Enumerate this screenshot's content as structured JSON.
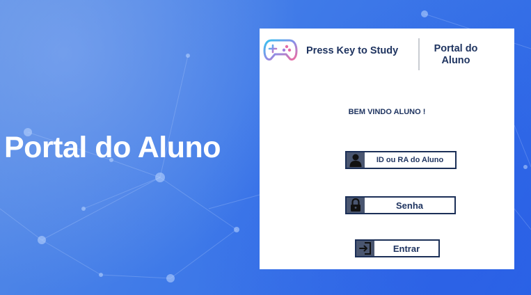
{
  "hero": {
    "title": "Portal do Aluno"
  },
  "header": {
    "brand": "Press Key to Study",
    "portal_label": "Portal do Aluno",
    "logo_icon": "gamepad-icon"
  },
  "form": {
    "welcome": "BEM VINDO ALUNO !",
    "id_field": {
      "label": "ID ou RA do Aluno",
      "icon": "user-icon"
    },
    "password_field": {
      "label": "Senha",
      "icon": "lock-icon"
    },
    "submit": {
      "label": "Entrar",
      "icon": "login-icon"
    }
  },
  "colors": {
    "background": "#3f7ae8",
    "text_dark": "#1f3460",
    "border": "#1b2f57",
    "icon_bg": "#4a5670"
  }
}
